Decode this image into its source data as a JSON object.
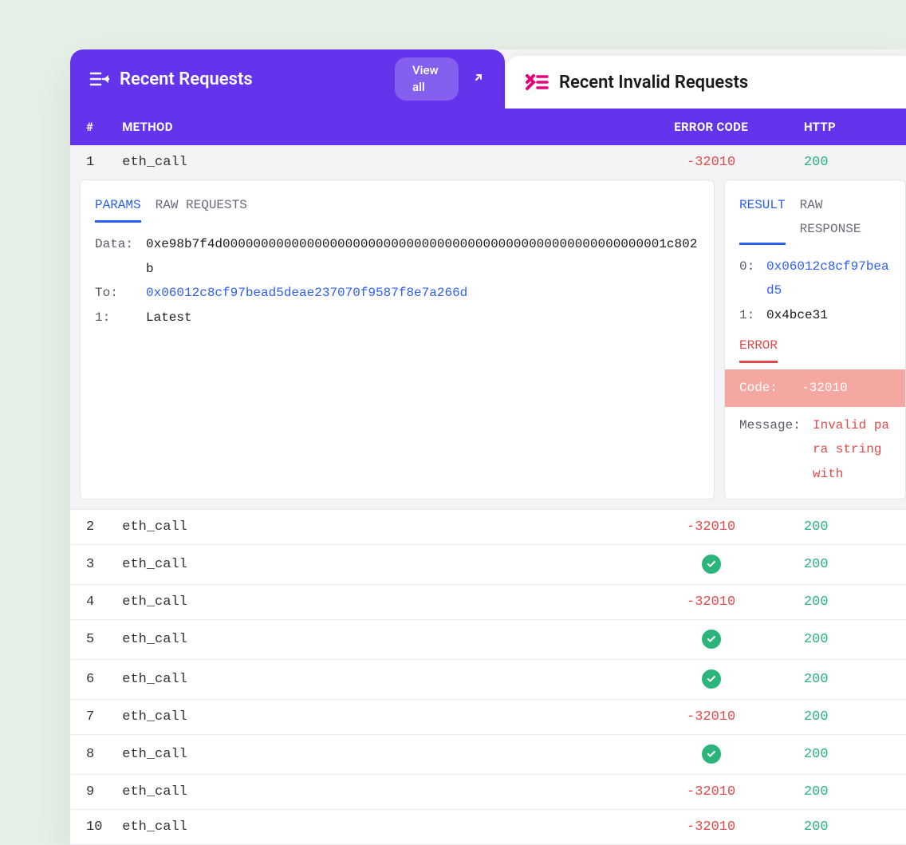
{
  "tabs": {
    "active": {
      "title": "Recent Requests",
      "view_all": "View all"
    },
    "inactive": {
      "title": "Recent Invalid Requests"
    }
  },
  "columns": {
    "num": "#",
    "method": "METHOD",
    "error": "ERROR CODE",
    "http": "HTTP"
  },
  "detail": {
    "left": {
      "tabs": {
        "params": "PARAMS",
        "raw": "RAW REQUESTS"
      },
      "rows": [
        {
          "key": "Data:",
          "val": "0xe98b7f4d0000000000000000000000000000000000000000000000000000000001c802b",
          "link": false
        },
        {
          "key": "To:",
          "val": "0x06012c8cf97bead5deae237070f9587f8e7a266d",
          "link": true
        },
        {
          "key": "1:",
          "val": "Latest",
          "link": false
        }
      ]
    },
    "right": {
      "tabs": {
        "result": "RESULT",
        "raw": "RAW RESPONSE"
      },
      "rows": [
        {
          "key": "0:",
          "val": "0x06012c8cf97bead5",
          "link": true
        },
        {
          "key": "1:",
          "val": "0x4bce31",
          "link": false
        }
      ],
      "error_label": "ERROR",
      "error_code_key": "Code:",
      "error_code_val": "-32010",
      "error_msg_key": "Message:",
      "error_msg_val": "Invalid para string with"
    }
  },
  "rows": [
    {
      "n": "1",
      "method": "eth_call",
      "error": "-32010",
      "ok": false,
      "http": "200",
      "expanded": true
    },
    {
      "n": "2",
      "method": "eth_call",
      "error": "-32010",
      "ok": false,
      "http": "200"
    },
    {
      "n": "3",
      "method": "eth_call",
      "error": "",
      "ok": true,
      "http": "200"
    },
    {
      "n": "4",
      "method": "eth_call",
      "error": "-32010",
      "ok": false,
      "http": "200"
    },
    {
      "n": "5",
      "method": "eth_call",
      "error": "",
      "ok": true,
      "http": "200"
    },
    {
      "n": "6",
      "method": "eth_call",
      "error": "",
      "ok": true,
      "http": "200"
    },
    {
      "n": "7",
      "method": "eth_call",
      "error": "-32010",
      "ok": false,
      "http": "200"
    },
    {
      "n": "8",
      "method": "eth_call",
      "error": "",
      "ok": true,
      "http": "200"
    },
    {
      "n": "9",
      "method": "eth_call",
      "error": "-32010",
      "ok": false,
      "http": "200"
    },
    {
      "n": "10",
      "method": "eth_call",
      "error": "-32010",
      "ok": false,
      "http": "200"
    }
  ]
}
